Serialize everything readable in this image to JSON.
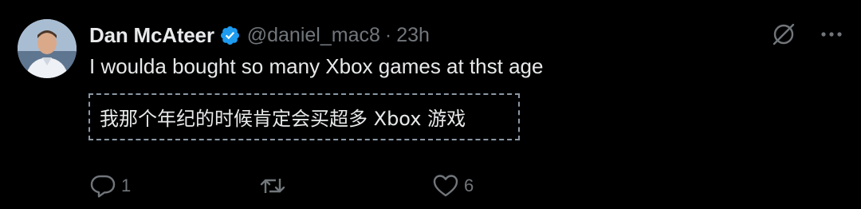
{
  "author": {
    "name": "Dan McAteer",
    "handle": "@daniel_mac8",
    "separator": "·",
    "time": "23h",
    "verified": true
  },
  "tweet": {
    "text": "I woulda bought so many Xbox games at thst age",
    "translation": "我那个年纪的时候肯定会买超多 Xbox 游戏"
  },
  "actions": {
    "reply_count": "1",
    "retweet_count": "",
    "like_count": "6"
  },
  "icons": {
    "verified": "verified-badge-icon",
    "grok": "grok-slash-circle-icon",
    "more": "more-dots-icon",
    "reply": "reply-bubble-icon",
    "retweet": "retweet-arrows-icon",
    "like": "heart-icon"
  },
  "colors": {
    "background": "#000000",
    "text_primary": "#e7e9ea",
    "text_secondary": "#71767b",
    "verified_blue": "#1d9bf0",
    "dashed_border": "#8b98a5"
  }
}
